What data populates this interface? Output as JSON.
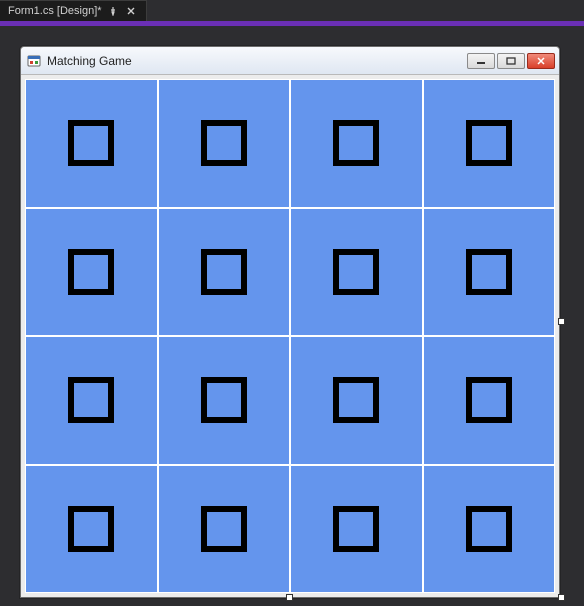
{
  "ide": {
    "tab_label": "Form1.cs [Design]*"
  },
  "form": {
    "title": "Matching Game"
  },
  "grid": {
    "rows": 4,
    "cols": 4
  }
}
